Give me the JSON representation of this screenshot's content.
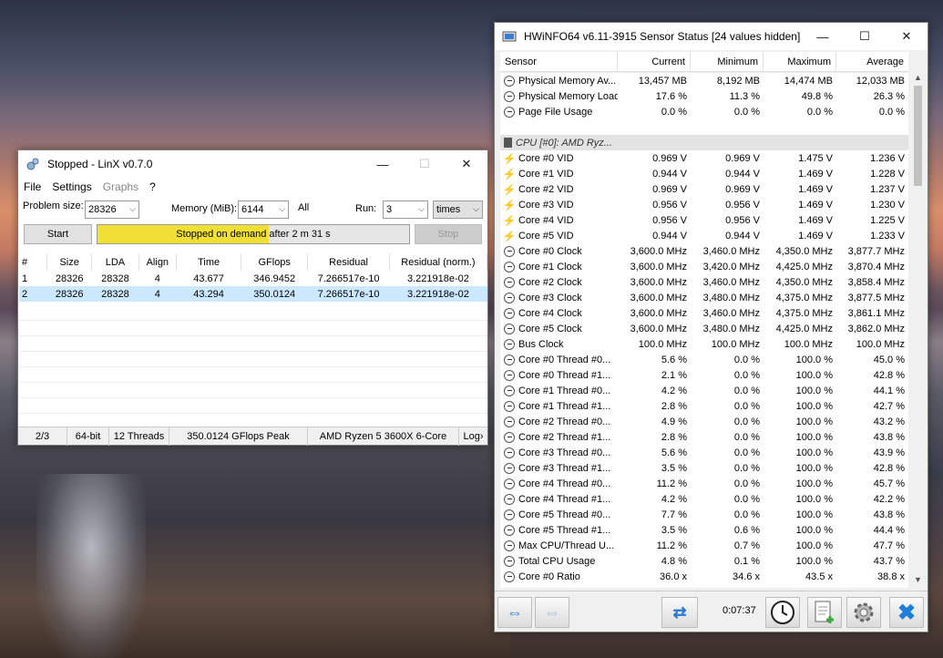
{
  "linx": {
    "title": "Stopped - LinX v0.7.0",
    "menu": [
      "File",
      "Settings",
      "Graphs",
      "?"
    ],
    "problem_size_label": "Problem size:",
    "problem_size": "28326",
    "memory_label": "Memory (MiB):",
    "memory": "6144",
    "all_label": "All",
    "run_label": "Run:",
    "run": "3",
    "run_unit": "times",
    "start": "Start",
    "stop": "Stop",
    "progress_text": "Stopped on demand after 2 m 31 s",
    "progress_fraction": 0.55,
    "columns": [
      "#",
      "Size",
      "LDA",
      "Align",
      "Time",
      "GFlops",
      "Residual",
      "Residual (norm.)"
    ],
    "rows": [
      [
        "1",
        "28326",
        "28328",
        "4",
        "43.677",
        "346.9452",
        "7.266517e-10",
        "3.221918e-02"
      ],
      [
        "2",
        "28326",
        "28328",
        "4",
        "43.294",
        "350.0124",
        "7.266517e-10",
        "3.221918e-02"
      ]
    ],
    "status": [
      "2/3",
      "64-bit",
      "12 Threads",
      "350.0124 GFlops Peak",
      "AMD Ryzen 5 3600X 6-Core",
      "Log"
    ]
  },
  "hw": {
    "title": "HWiNFO64 v6.11-3915 Sensor Status [24 values hidden]",
    "columns": [
      "Sensor",
      "Current",
      "Minimum",
      "Maximum",
      "Average"
    ],
    "rows": [
      {
        "icon": "clock",
        "name": "Physical Memory Av...",
        "v": [
          "13,457 MB",
          "8,192 MB",
          "14,474 MB",
          "12,033 MB"
        ]
      },
      {
        "icon": "clock",
        "name": "Physical Memory Load",
        "v": [
          "17.6 %",
          "11.3 %",
          "49.8 %",
          "26.3 %"
        ]
      },
      {
        "icon": "clock",
        "name": "Page File Usage",
        "v": [
          "0.0 %",
          "0.0 %",
          "0.0 %",
          "0.0 %"
        ]
      },
      {
        "icon": "none",
        "name": "",
        "v": [
          "",
          "",
          "",
          ""
        ]
      },
      {
        "icon": "chip",
        "name": "CPU [#0]: AMD Ryz...",
        "v": [
          "",
          "",
          "",
          ""
        ],
        "group": true
      },
      {
        "icon": "bolt",
        "name": "Core #0 VID",
        "v": [
          "0.969 V",
          "0.969 V",
          "1.475 V",
          "1.236 V"
        ]
      },
      {
        "icon": "bolt",
        "name": "Core #1 VID",
        "v": [
          "0.944 V",
          "0.944 V",
          "1.469 V",
          "1.228 V"
        ]
      },
      {
        "icon": "bolt",
        "name": "Core #2 VID",
        "v": [
          "0.969 V",
          "0.969 V",
          "1.469 V",
          "1.237 V"
        ]
      },
      {
        "icon": "bolt",
        "name": "Core #3 VID",
        "v": [
          "0.956 V",
          "0.956 V",
          "1.469 V",
          "1.230 V"
        ]
      },
      {
        "icon": "bolt",
        "name": "Core #4 VID",
        "v": [
          "0.956 V",
          "0.956 V",
          "1.469 V",
          "1.225 V"
        ]
      },
      {
        "icon": "bolt",
        "name": "Core #5 VID",
        "v": [
          "0.944 V",
          "0.944 V",
          "1.469 V",
          "1.233 V"
        ]
      },
      {
        "icon": "clock",
        "name": "Core #0 Clock",
        "v": [
          "3,600.0 MHz",
          "3,460.0 MHz",
          "4,350.0 MHz",
          "3,877.7 MHz"
        ]
      },
      {
        "icon": "clock",
        "name": "Core #1 Clock",
        "v": [
          "3,600.0 MHz",
          "3,420.0 MHz",
          "4,425.0 MHz",
          "3,870.4 MHz"
        ]
      },
      {
        "icon": "clock",
        "name": "Core #2 Clock",
        "v": [
          "3,600.0 MHz",
          "3,460.0 MHz",
          "4,350.0 MHz",
          "3,858.4 MHz"
        ]
      },
      {
        "icon": "clock",
        "name": "Core #3 Clock",
        "v": [
          "3,600.0 MHz",
          "3,480.0 MHz",
          "4,375.0 MHz",
          "3,877.5 MHz"
        ]
      },
      {
        "icon": "clock",
        "name": "Core #4 Clock",
        "v": [
          "3,600.0 MHz",
          "3,460.0 MHz",
          "4,375.0 MHz",
          "3,861.1 MHz"
        ]
      },
      {
        "icon": "clock",
        "name": "Core #5 Clock",
        "v": [
          "3,600.0 MHz",
          "3,480.0 MHz",
          "4,425.0 MHz",
          "3,862.0 MHz"
        ]
      },
      {
        "icon": "clock",
        "name": "Bus Clock",
        "v": [
          "100.0 MHz",
          "100.0 MHz",
          "100.0 MHz",
          "100.0 MHz"
        ]
      },
      {
        "icon": "clock",
        "name": "Core #0 Thread #0...",
        "v": [
          "5.6 %",
          "0.0 %",
          "100.0 %",
          "45.0 %"
        ]
      },
      {
        "icon": "clock",
        "name": "Core #0 Thread #1...",
        "v": [
          "2.1 %",
          "0.0 %",
          "100.0 %",
          "42.8 %"
        ]
      },
      {
        "icon": "clock",
        "name": "Core #1 Thread #0...",
        "v": [
          "4.2 %",
          "0.0 %",
          "100.0 %",
          "44.1 %"
        ]
      },
      {
        "icon": "clock",
        "name": "Core #1 Thread #1...",
        "v": [
          "2.8 %",
          "0.0 %",
          "100.0 %",
          "42.7 %"
        ]
      },
      {
        "icon": "clock",
        "name": "Core #2 Thread #0...",
        "v": [
          "4.9 %",
          "0.0 %",
          "100.0 %",
          "43.2 %"
        ]
      },
      {
        "icon": "clock",
        "name": "Core #2 Thread #1...",
        "v": [
          "2.8 %",
          "0.0 %",
          "100.0 %",
          "43.8 %"
        ]
      },
      {
        "icon": "clock",
        "name": "Core #3 Thread #0...",
        "v": [
          "5.6 %",
          "0.0 %",
          "100.0 %",
          "43.9 %"
        ]
      },
      {
        "icon": "clock",
        "name": "Core #3 Thread #1...",
        "v": [
          "3.5 %",
          "0.0 %",
          "100.0 %",
          "42.8 %"
        ]
      },
      {
        "icon": "clock",
        "name": "Core #4 Thread #0...",
        "v": [
          "11.2 %",
          "0.0 %",
          "100.0 %",
          "45.7 %"
        ]
      },
      {
        "icon": "clock",
        "name": "Core #4 Thread #1...",
        "v": [
          "4.2 %",
          "0.0 %",
          "100.0 %",
          "42.2 %"
        ]
      },
      {
        "icon": "clock",
        "name": "Core #5 Thread #0...",
        "v": [
          "7.7 %",
          "0.0 %",
          "100.0 %",
          "43.8 %"
        ]
      },
      {
        "icon": "clock",
        "name": "Core #5 Thread #1...",
        "v": [
          "3.5 %",
          "0.6 %",
          "100.0 %",
          "44.4 %"
        ]
      },
      {
        "icon": "clock",
        "name": "Max CPU/Thread U...",
        "v": [
          "11.2 %",
          "0.7 %",
          "100.0 %",
          "47.7 %"
        ]
      },
      {
        "icon": "clock",
        "name": "Total CPU Usage",
        "v": [
          "4.8 %",
          "0.1 %",
          "100.0 %",
          "43.7 %"
        ]
      },
      {
        "icon": "clock",
        "name": "Core #0 Ratio",
        "v": [
          "36.0 x",
          "34.6 x",
          "43.5 x",
          "38.8 x"
        ]
      }
    ],
    "timer": "0:07:37"
  },
  "colors": {
    "progress": "#f0e033",
    "selected_row": "#cce8ff",
    "close_x": "#1f7fd8"
  }
}
